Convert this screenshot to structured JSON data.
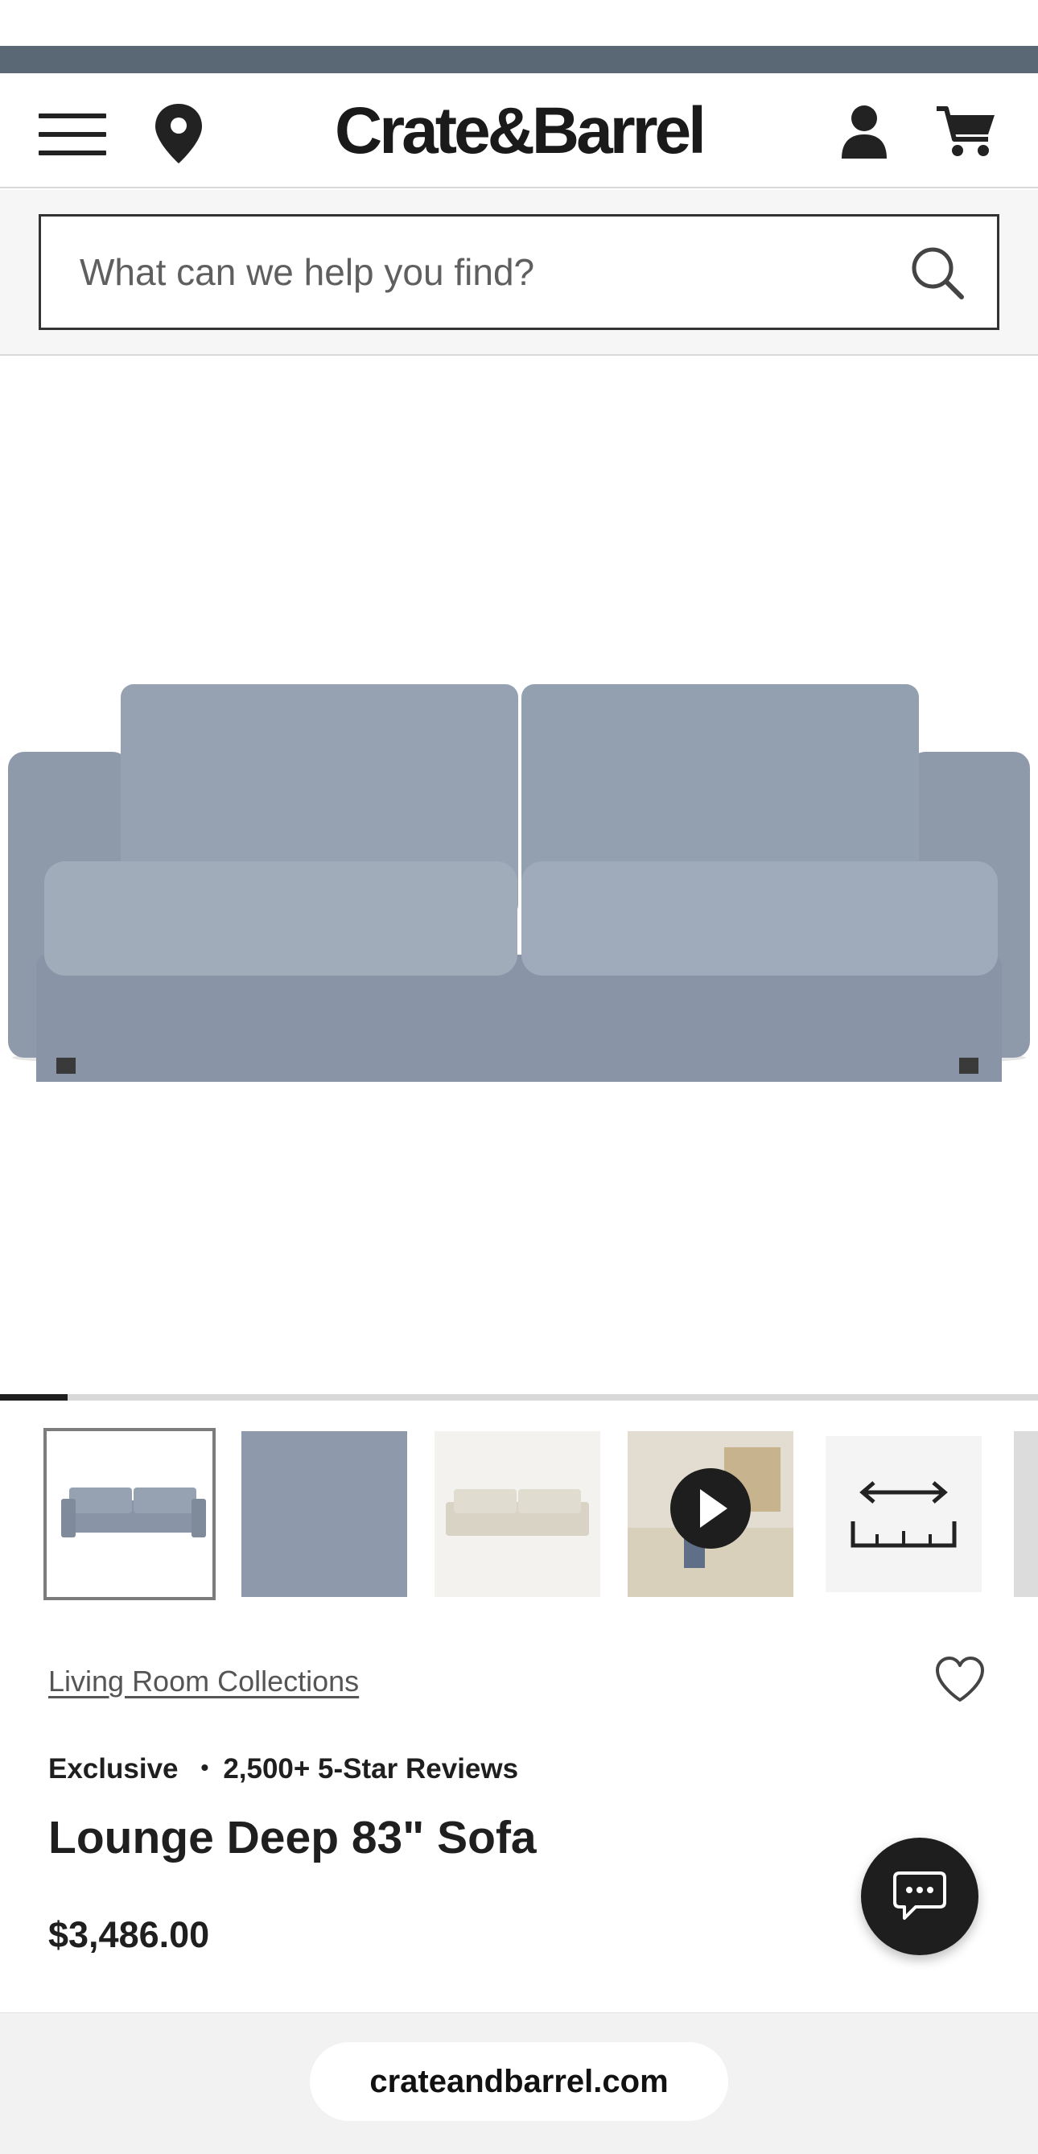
{
  "header": {
    "logo": "Crate&Barrel",
    "icons": [
      "menu-icon",
      "location-pin-icon",
      "account-icon",
      "cart-icon"
    ]
  },
  "search": {
    "placeholder": "What can we help you find?"
  },
  "gallery": {
    "progress_fraction": 0.065,
    "thumbnails": [
      {
        "name": "thumb-sofa-front",
        "active": true
      },
      {
        "name": "thumb-fabric-swatch",
        "active": false
      },
      {
        "name": "thumb-sofa-cream",
        "active": false
      },
      {
        "name": "thumb-video",
        "active": false
      },
      {
        "name": "thumb-dimensions",
        "active": false
      },
      {
        "name": "thumb-room",
        "active": false
      }
    ]
  },
  "product": {
    "collection_link": "Living Room Collections",
    "badge": "Exclusive",
    "reviews": "2,500+ 5-Star Reviews",
    "title": "Lounge Deep 83\" Sofa",
    "price": "$3,486.00"
  },
  "browser": {
    "url": "crateandbarrel.com"
  },
  "colors": {
    "top_bar": "#5a6775",
    "sofa": "#8f9bab",
    "text": "#1f1f1f",
    "chat_button": "#1e1e1e"
  }
}
